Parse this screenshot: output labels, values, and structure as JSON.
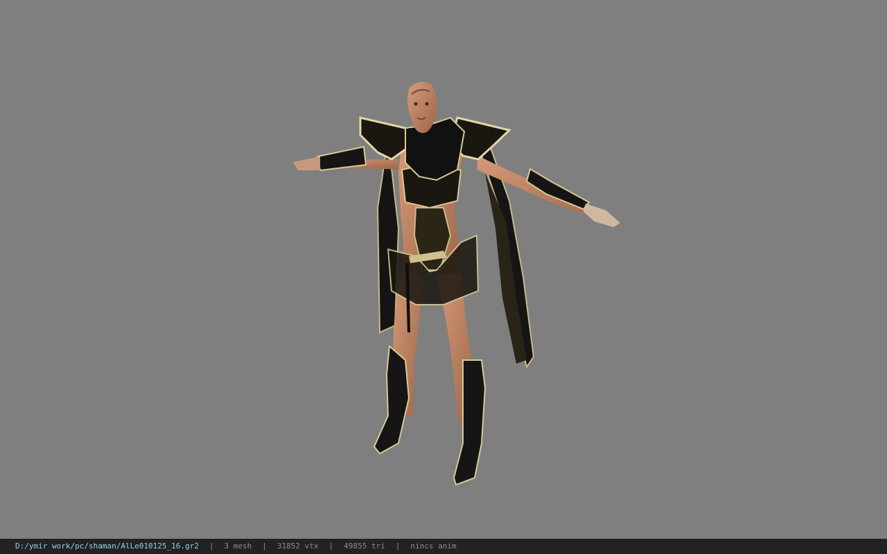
{
  "viewer": {
    "background_color": "#7f7f7f",
    "model_name": "shaman"
  },
  "statusbar": {
    "file_path": "D:/ymir work/pc/shaman/AlLe010125_16.gr2",
    "separator": "|",
    "mesh_count": "3 mesh",
    "vertex_count": "31852 vtx",
    "triangle_count": "49855 tri",
    "animation": "nincs anim",
    "path_color": "#8fd3e8",
    "text_color": "#8c8c8c"
  }
}
